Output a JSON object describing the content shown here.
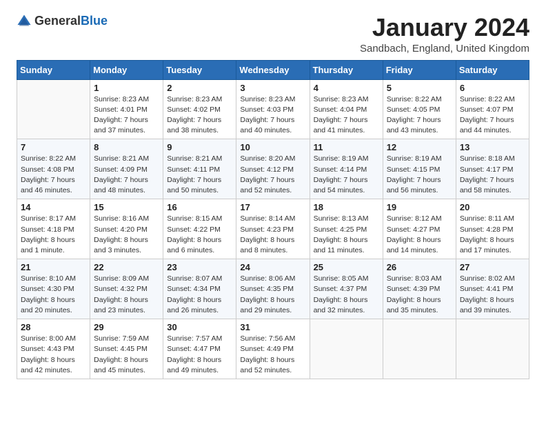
{
  "header": {
    "logo_general": "General",
    "logo_blue": "Blue",
    "month_title": "January 2024",
    "location": "Sandbach, England, United Kingdom"
  },
  "days_of_week": [
    "Sunday",
    "Monday",
    "Tuesday",
    "Wednesday",
    "Thursday",
    "Friday",
    "Saturday"
  ],
  "weeks": [
    [
      {
        "day": "",
        "sunrise": "",
        "sunset": "",
        "daylight": ""
      },
      {
        "day": "1",
        "sunrise": "Sunrise: 8:23 AM",
        "sunset": "Sunset: 4:01 PM",
        "daylight": "Daylight: 7 hours and 37 minutes."
      },
      {
        "day": "2",
        "sunrise": "Sunrise: 8:23 AM",
        "sunset": "Sunset: 4:02 PM",
        "daylight": "Daylight: 7 hours and 38 minutes."
      },
      {
        "day": "3",
        "sunrise": "Sunrise: 8:23 AM",
        "sunset": "Sunset: 4:03 PM",
        "daylight": "Daylight: 7 hours and 40 minutes."
      },
      {
        "day": "4",
        "sunrise": "Sunrise: 8:23 AM",
        "sunset": "Sunset: 4:04 PM",
        "daylight": "Daylight: 7 hours and 41 minutes."
      },
      {
        "day": "5",
        "sunrise": "Sunrise: 8:22 AM",
        "sunset": "Sunset: 4:05 PM",
        "daylight": "Daylight: 7 hours and 43 minutes."
      },
      {
        "day": "6",
        "sunrise": "Sunrise: 8:22 AM",
        "sunset": "Sunset: 4:07 PM",
        "daylight": "Daylight: 7 hours and 44 minutes."
      }
    ],
    [
      {
        "day": "7",
        "sunrise": "Sunrise: 8:22 AM",
        "sunset": "Sunset: 4:08 PM",
        "daylight": "Daylight: 7 hours and 46 minutes."
      },
      {
        "day": "8",
        "sunrise": "Sunrise: 8:21 AM",
        "sunset": "Sunset: 4:09 PM",
        "daylight": "Daylight: 7 hours and 48 minutes."
      },
      {
        "day": "9",
        "sunrise": "Sunrise: 8:21 AM",
        "sunset": "Sunset: 4:11 PM",
        "daylight": "Daylight: 7 hours and 50 minutes."
      },
      {
        "day": "10",
        "sunrise": "Sunrise: 8:20 AM",
        "sunset": "Sunset: 4:12 PM",
        "daylight": "Daylight: 7 hours and 52 minutes."
      },
      {
        "day": "11",
        "sunrise": "Sunrise: 8:19 AM",
        "sunset": "Sunset: 4:14 PM",
        "daylight": "Daylight: 7 hours and 54 minutes."
      },
      {
        "day": "12",
        "sunrise": "Sunrise: 8:19 AM",
        "sunset": "Sunset: 4:15 PM",
        "daylight": "Daylight: 7 hours and 56 minutes."
      },
      {
        "day": "13",
        "sunrise": "Sunrise: 8:18 AM",
        "sunset": "Sunset: 4:17 PM",
        "daylight": "Daylight: 7 hours and 58 minutes."
      }
    ],
    [
      {
        "day": "14",
        "sunrise": "Sunrise: 8:17 AM",
        "sunset": "Sunset: 4:18 PM",
        "daylight": "Daylight: 8 hours and 1 minute."
      },
      {
        "day": "15",
        "sunrise": "Sunrise: 8:16 AM",
        "sunset": "Sunset: 4:20 PM",
        "daylight": "Daylight: 8 hours and 3 minutes."
      },
      {
        "day": "16",
        "sunrise": "Sunrise: 8:15 AM",
        "sunset": "Sunset: 4:22 PM",
        "daylight": "Daylight: 8 hours and 6 minutes."
      },
      {
        "day": "17",
        "sunrise": "Sunrise: 8:14 AM",
        "sunset": "Sunset: 4:23 PM",
        "daylight": "Daylight: 8 hours and 8 minutes."
      },
      {
        "day": "18",
        "sunrise": "Sunrise: 8:13 AM",
        "sunset": "Sunset: 4:25 PM",
        "daylight": "Daylight: 8 hours and 11 minutes."
      },
      {
        "day": "19",
        "sunrise": "Sunrise: 8:12 AM",
        "sunset": "Sunset: 4:27 PM",
        "daylight": "Daylight: 8 hours and 14 minutes."
      },
      {
        "day": "20",
        "sunrise": "Sunrise: 8:11 AM",
        "sunset": "Sunset: 4:28 PM",
        "daylight": "Daylight: 8 hours and 17 minutes."
      }
    ],
    [
      {
        "day": "21",
        "sunrise": "Sunrise: 8:10 AM",
        "sunset": "Sunset: 4:30 PM",
        "daylight": "Daylight: 8 hours and 20 minutes."
      },
      {
        "day": "22",
        "sunrise": "Sunrise: 8:09 AM",
        "sunset": "Sunset: 4:32 PM",
        "daylight": "Daylight: 8 hours and 23 minutes."
      },
      {
        "day": "23",
        "sunrise": "Sunrise: 8:07 AM",
        "sunset": "Sunset: 4:34 PM",
        "daylight": "Daylight: 8 hours and 26 minutes."
      },
      {
        "day": "24",
        "sunrise": "Sunrise: 8:06 AM",
        "sunset": "Sunset: 4:35 PM",
        "daylight": "Daylight: 8 hours and 29 minutes."
      },
      {
        "day": "25",
        "sunrise": "Sunrise: 8:05 AM",
        "sunset": "Sunset: 4:37 PM",
        "daylight": "Daylight: 8 hours and 32 minutes."
      },
      {
        "day": "26",
        "sunrise": "Sunrise: 8:03 AM",
        "sunset": "Sunset: 4:39 PM",
        "daylight": "Daylight: 8 hours and 35 minutes."
      },
      {
        "day": "27",
        "sunrise": "Sunrise: 8:02 AM",
        "sunset": "Sunset: 4:41 PM",
        "daylight": "Daylight: 8 hours and 39 minutes."
      }
    ],
    [
      {
        "day": "28",
        "sunrise": "Sunrise: 8:00 AM",
        "sunset": "Sunset: 4:43 PM",
        "daylight": "Daylight: 8 hours and 42 minutes."
      },
      {
        "day": "29",
        "sunrise": "Sunrise: 7:59 AM",
        "sunset": "Sunset: 4:45 PM",
        "daylight": "Daylight: 8 hours and 45 minutes."
      },
      {
        "day": "30",
        "sunrise": "Sunrise: 7:57 AM",
        "sunset": "Sunset: 4:47 PM",
        "daylight": "Daylight: 8 hours and 49 minutes."
      },
      {
        "day": "31",
        "sunrise": "Sunrise: 7:56 AM",
        "sunset": "Sunset: 4:49 PM",
        "daylight": "Daylight: 8 hours and 52 minutes."
      },
      {
        "day": "",
        "sunrise": "",
        "sunset": "",
        "daylight": ""
      },
      {
        "day": "",
        "sunrise": "",
        "sunset": "",
        "daylight": ""
      },
      {
        "day": "",
        "sunrise": "",
        "sunset": "",
        "daylight": ""
      }
    ]
  ]
}
